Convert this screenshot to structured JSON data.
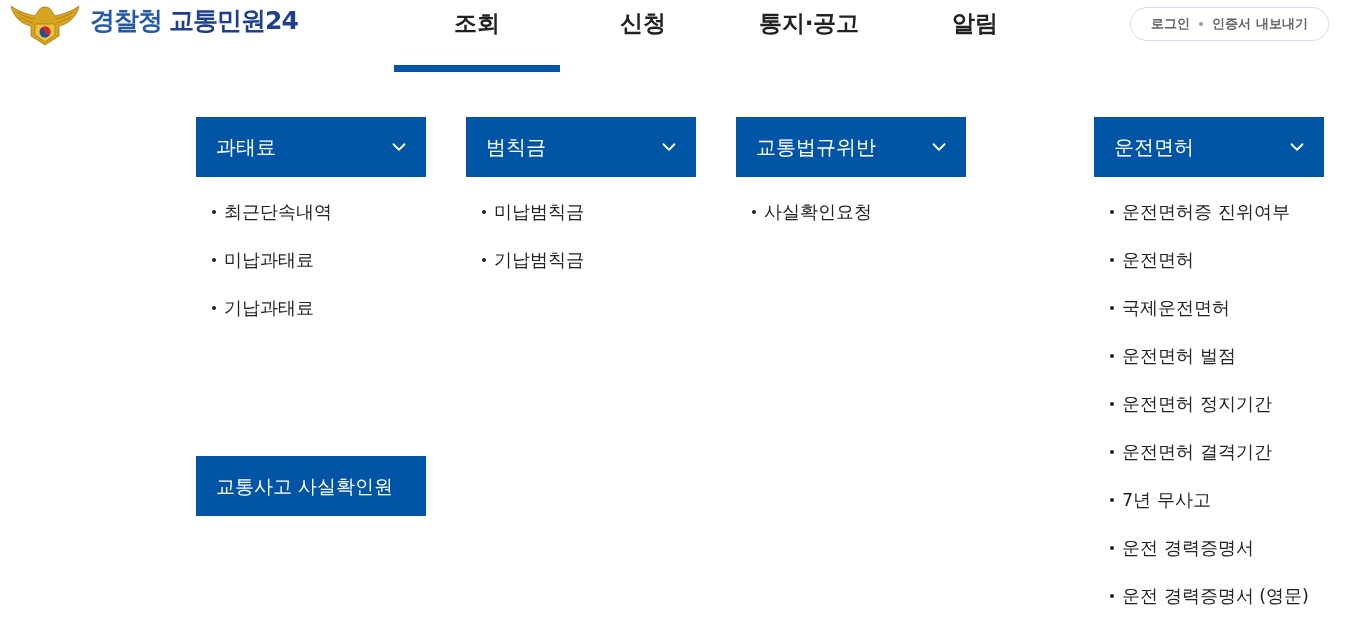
{
  "header": {
    "logo": {
      "org": "경찰청",
      "service": "교통민원24"
    },
    "nav": [
      {
        "label": "조회",
        "selected": true
      },
      {
        "label": "신청",
        "selected": false
      },
      {
        "label": "통지·공고",
        "selected": false
      },
      {
        "label": "알림",
        "selected": false
      }
    ],
    "account_links": [
      "로그인",
      "인증서 내보내기"
    ]
  },
  "menu": {
    "columns": [
      {
        "sections": [
          {
            "kind": "dropdown",
            "title": "과태료",
            "items": [
              "최근단속내역",
              "미납과태료",
              "기납과태료"
            ]
          },
          {
            "kind": "link",
            "title": "교통사고 사실확인원"
          }
        ]
      },
      {
        "sections": [
          {
            "kind": "dropdown",
            "title": "범칙금",
            "items": [
              "미납범칙금",
              "기납범칙금"
            ]
          }
        ]
      },
      {
        "sections": [
          {
            "kind": "dropdown",
            "title": "교통법규위반",
            "items": [
              "사실확인요청"
            ]
          }
        ]
      },
      {
        "sections": [
          {
            "kind": "dropdown",
            "title": "운전면허",
            "items": [
              "운전면허증 진위여부",
              "운전면허",
              "국제운전면허",
              "운전면허 벌점",
              "운전면허 정지기간",
              "운전면허 결격기간",
              "7년 무사고",
              "운전 경력증명서",
              "운전 경력증명서 (영문)"
            ]
          }
        ]
      }
    ]
  }
}
